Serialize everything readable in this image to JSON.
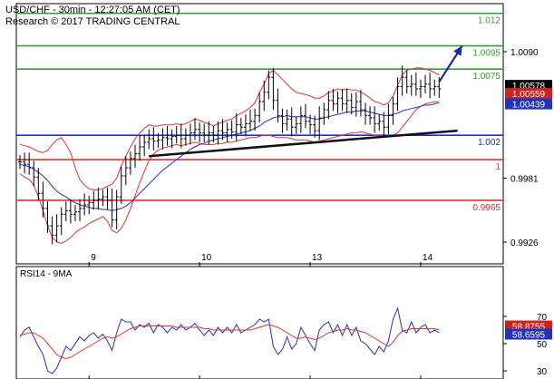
{
  "header": {
    "line1": "USD/CHF - 30min - 12:27:05 AM (CET)",
    "line2": "Research © 2017 TRADING CENTRAL"
  },
  "chart_data": [
    {
      "type": "line",
      "panel": "price",
      "ylim": [
        0.9898,
        1.0123
      ],
      "y_ticks": [
        1.009,
        0.9981,
        0.9926
      ],
      "y_tick_labels": [
        "1.0090",
        "0.9981",
        "0.9926"
      ],
      "x_ticks": [
        {
          "label": "9",
          "i": 15
        },
        {
          "label": "10",
          "i": 39
        },
        {
          "label": "13",
          "i": 63
        },
        {
          "label": "14",
          "i": 87
        }
      ],
      "levels": [
        {
          "label": "1.012",
          "value": 1.0123,
          "color": "#3a9a3a"
        },
        {
          "label": "1.0095",
          "value": 1.0095,
          "color": "#3a9a3a"
        },
        {
          "label": "1.0075",
          "value": 1.0075,
          "color": "#3a9a3a"
        },
        {
          "label": "1.002",
          "value": 1.0018,
          "color": "#2233bb"
        },
        {
          "label": "1",
          "value": 0.9997,
          "color": "#dd3333"
        },
        {
          "label": "0.9965",
          "value": 0.9962,
          "color": "#dd3333"
        }
      ],
      "price_close": [
        0.9995,
        0.9993,
        0.999,
        0.9982,
        0.9968,
        0.9955,
        0.994,
        0.9932,
        0.994,
        0.995,
        0.9953,
        0.995,
        0.9952,
        0.9955,
        0.9958,
        0.996,
        0.9962,
        0.9963,
        0.9965,
        0.9962,
        0.9945,
        0.9965,
        0.9983,
        0.999,
        0.9998,
        1.0002,
        1.0008,
        1.0012,
        1.0015,
        1.0013,
        1.0014,
        1.0016,
        1.0015,
        1.0017,
        1.0018,
        1.0015,
        1.0018,
        1.002,
        1.0023,
        1.002,
        1.0018,
        1.002,
        1.0018,
        1.0022,
        1.002,
        1.0023,
        1.0021,
        1.0027,
        1.0025,
        1.0028,
        1.003,
        1.0035,
        1.0047,
        1.0055,
        1.0068,
        1.0048,
        1.0035,
        1.0028,
        1.0032,
        1.0025,
        1.0028,
        1.0035,
        1.003,
        1.0027,
        1.0022,
        1.0033,
        1.004,
        1.0048,
        1.0045,
        1.005,
        1.0045,
        1.0048,
        1.0042,
        1.0047,
        1.004,
        1.0035,
        1.0033,
        1.0028,
        1.003,
        1.0025,
        1.0035,
        1.0045,
        1.006,
        1.0068,
        1.006,
        1.0062,
        1.0058,
        1.006,
        1.0062,
        1.0058,
        1.006,
        1.0058
      ],
      "ma_blue": [
        0.9993,
        0.9992,
        0.9991,
        0.9989,
        0.9986,
        0.9983,
        0.9979,
        0.9974,
        0.997,
        0.9967,
        0.9965,
        0.9962,
        0.996,
        0.9958,
        0.9957,
        0.9956,
        0.9955,
        0.9955,
        0.9954,
        0.9954,
        0.9953,
        0.9954,
        0.9955,
        0.9957,
        0.996,
        0.9964,
        0.9968,
        0.9972,
        0.9976,
        0.998,
        0.9984,
        0.9988,
        0.9991,
        0.9994,
        0.9997,
        1.0,
        1.0003,
        1.0006,
        1.0008,
        1.001,
        1.0011,
        1.0013,
        1.0014,
        1.0015,
        1.0016,
        1.0017,
        1.0018,
        1.0019,
        1.002,
        1.0021,
        1.0022,
        1.0024,
        1.0026,
        1.0029,
        1.0031,
        1.0033,
        1.0034,
        1.0034,
        1.0035,
        1.0034,
        1.0034,
        1.0034,
        1.0034,
        1.0033,
        1.0032,
        1.0032,
        1.0033,
        1.0034,
        1.0035,
        1.0036,
        1.0037,
        1.0038,
        1.0038,
        1.0039,
        1.0039,
        1.0039,
        1.0038,
        1.0037,
        1.0036,
        1.0035,
        1.0035,
        1.0036,
        1.0037,
        1.0039,
        1.004,
        1.0041,
        1.0042,
        1.0043,
        1.0044,
        1.0044,
        1.0045,
        1.0046
      ],
      "bb_upper": [
        1.001,
        1.0009,
        1.0008,
        1.0006,
        1.0004,
        1.0003,
        1.0005,
        1.001,
        1.0014,
        1.0016,
        1.001,
        1.0003,
        0.999,
        0.998,
        0.9975,
        0.9972,
        0.9971,
        0.9971,
        0.9972,
        0.9974,
        0.9976,
        0.9981,
        0.9992,
        1.0,
        1.0008,
        1.0015,
        1.002,
        1.0024,
        1.0027,
        1.0026,
        1.0026,
        1.0027,
        1.0027,
        1.0027,
        1.0028,
        1.0027,
        1.0028,
        1.003,
        1.0032,
        1.0031,
        1.0029,
        1.0028,
        1.0026,
        1.0028,
        1.0029,
        1.0031,
        1.0032,
        1.0035,
        1.0037,
        1.0039,
        1.0042,
        1.0046,
        1.0055,
        1.0062,
        1.0071,
        1.0074,
        1.007,
        1.0066,
        1.0062,
        1.0058,
        1.0055,
        1.0054,
        1.0053,
        1.0052,
        1.005,
        1.005,
        1.0052,
        1.0055,
        1.0056,
        1.0058,
        1.0057,
        1.0058,
        1.0057,
        1.0057,
        1.0055,
        1.0053,
        1.005,
        1.0047,
        1.0046,
        1.0044,
        1.0046,
        1.0052,
        1.0061,
        1.007,
        1.0074,
        1.0075,
        1.0076,
        1.0076,
        1.0075,
        1.0074,
        1.0072,
        1.007
      ],
      "bb_lower": [
        0.9985,
        0.9982,
        0.998,
        0.9975,
        0.9965,
        0.9953,
        0.994,
        0.993,
        0.9926,
        0.9925,
        0.9927,
        0.993,
        0.9934,
        0.9937,
        0.9939,
        0.9942,
        0.9944,
        0.9946,
        0.9948,
        0.9944,
        0.9936,
        0.9934,
        0.9938,
        0.9945,
        0.9955,
        0.9966,
        0.9977,
        0.9987,
        0.9996,
        1.0002,
        1.0005,
        1.0007,
        1.0008,
        1.0009,
        1.001,
        1.0009,
        1.001,
        1.0011,
        1.0012,
        1.0011,
        1.001,
        1.001,
        1.001,
        1.0011,
        1.0011,
        1.0012,
        1.0012,
        1.0013,
        1.0014,
        1.0015,
        1.0016,
        1.0016,
        1.0017,
        1.0018,
        1.0018,
        1.0017,
        1.0016,
        1.0016,
        1.0016,
        1.0015,
        1.0014,
        1.0014,
        1.0014,
        1.0013,
        1.0012,
        1.0013,
        1.0014,
        1.0015,
        1.0016,
        1.0017,
        1.0018,
        1.0019,
        1.002,
        1.002,
        1.0021,
        1.002,
        1.0019,
        1.0018,
        1.0018,
        1.0017,
        1.0017,
        1.0018,
        1.002,
        1.0025,
        1.003,
        1.0035,
        1.004,
        1.0043,
        1.0045,
        1.0046,
        1.0047,
        1.0047
      ],
      "trendline": {
        "start": {
          "i": 28,
          "value": 1.0
        },
        "end": {
          "i": 95,
          "value": 1.0022
        }
      },
      "arrow": {
        "start": {
          "i": 91,
          "value": 1.0064
        },
        "end": {
          "i": 96,
          "value": 1.0095
        }
      },
      "price_labels": [
        {
          "text": "1.00578",
          "value": 1.0061,
          "bg": "#000000"
        },
        {
          "text": "1.00559",
          "value": 1.0054,
          "bg": "#cc2222"
        },
        {
          "text": "1.00439",
          "value": 1.0045,
          "bg": "#2233bb"
        }
      ]
    },
    {
      "type": "line",
      "panel": "indicator",
      "title": "RSI14 - 9MA",
      "ylim": [
        25,
        86
      ],
      "y_ticks": [
        70,
        50,
        30
      ],
      "series": [
        {
          "name": "RSI14",
          "color": "#2233bb",
          "values": [
            55,
            60,
            62,
            55,
            48,
            42,
            30,
            28,
            32,
            40,
            48,
            45,
            50,
            55,
            52,
            56,
            58,
            54,
            57,
            52,
            45,
            58,
            68,
            66,
            66,
            60,
            64,
            62,
            65,
            58,
            64,
            62,
            58,
            62,
            60,
            64,
            60,
            62,
            65,
            60,
            56,
            60,
            56,
            62,
            58,
            62,
            58,
            64,
            58,
            60,
            62,
            64,
            68,
            66,
            68,
            48,
            42,
            46,
            55,
            46,
            50,
            62,
            56,
            50,
            45,
            60,
            64,
            66,
            58,
            64,
            56,
            64,
            56,
            62,
            52,
            50,
            46,
            42,
            48,
            44,
            52,
            68,
            76,
            60,
            58,
            66,
            58,
            62,
            64,
            58,
            60,
            58
          ]
        },
        {
          "name": "9MA",
          "color": "#dd3333",
          "values": [
            56,
            57,
            58,
            58,
            56,
            54,
            50,
            46,
            42,
            40,
            39,
            40,
            42,
            44,
            46,
            48,
            50,
            52,
            54,
            55,
            54,
            55,
            57,
            59,
            61,
            62,
            63,
            63,
            63,
            63,
            63,
            63,
            63,
            63,
            62,
            62,
            62,
            62,
            62,
            62,
            61,
            61,
            60,
            60,
            60,
            60,
            60,
            60,
            60,
            60,
            60,
            61,
            62,
            63,
            64,
            63,
            62,
            60,
            58,
            56,
            54,
            54,
            55,
            54,
            53,
            54,
            56,
            58,
            59,
            60,
            60,
            61,
            60,
            60,
            59,
            58,
            56,
            54,
            52,
            50,
            48,
            51,
            56,
            59,
            60,
            61,
            61,
            61,
            61,
            61,
            61,
            60
          ]
        }
      ],
      "value_labels": [
        {
          "text": "58.8755",
          "value": 63,
          "bg": "#cc2222"
        },
        {
          "text": "58.6595",
          "value": 57,
          "bg": "#2233bb"
        }
      ]
    }
  ]
}
